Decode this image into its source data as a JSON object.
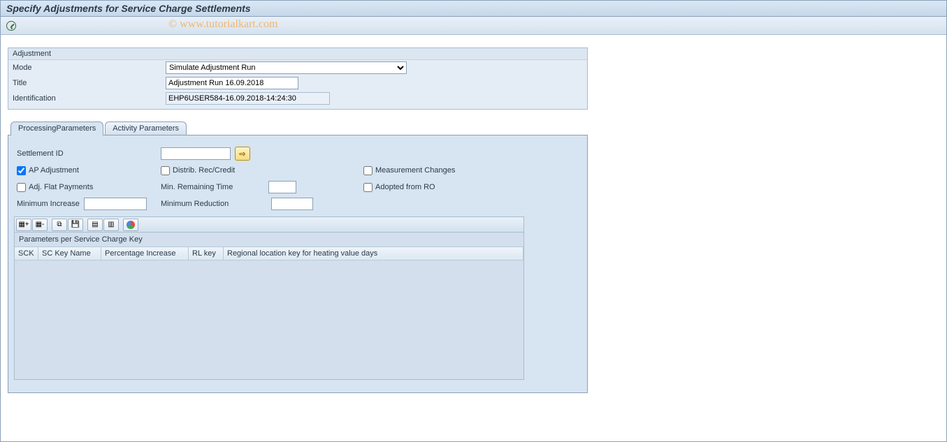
{
  "header": {
    "title": "Specify Adjustments for Service Charge Settlements"
  },
  "watermark": "© www.tutorialkart.com",
  "adjustment": {
    "group_title": "Adjustment",
    "mode_label": "Mode",
    "mode_value": "Simulate Adjustment Run",
    "title_label": "Title",
    "title_value": "Adjustment Run 16.09.2018",
    "identification_label": "Identification",
    "identification_value": "EHP6USER584-16.09.2018-14:24:30"
  },
  "tabs": {
    "processing": "ProcessingParameters",
    "activity": "Activity Parameters"
  },
  "params": {
    "settlement_id_label": "Settlement ID",
    "settlement_id_value": "",
    "ap_adjustment": {
      "label": "AP Adjustment",
      "checked": true
    },
    "distrib_rec_credit": {
      "label": "Distrib. Rec/Credit",
      "checked": false
    },
    "measurement_changes": {
      "label": "Measurement Changes",
      "checked": false
    },
    "adj_flat_payments": {
      "label": "Adj. Flat Payments",
      "checked": false
    },
    "min_remaining_time": {
      "label": "Min. Remaining Time",
      "value": ""
    },
    "adopted_from_ro": {
      "label": "Adopted from RO",
      "checked": false
    },
    "minimum_increase": {
      "label": "Minimum Increase",
      "value": ""
    },
    "minimum_reduction": {
      "label": "Minimum Reduction",
      "value": ""
    }
  },
  "alv": {
    "caption": "Parameters per Service Charge Key",
    "columns": {
      "c1": "SCK",
      "c2": "SC Key Name",
      "c3": "Percentage Increase",
      "c4": "RL key",
      "c5": "Regional location key for heating value days"
    }
  }
}
